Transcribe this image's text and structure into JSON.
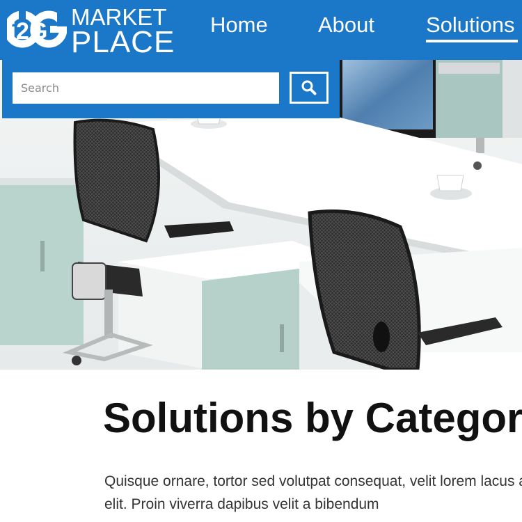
{
  "brand": {
    "logo_mark_text": "i2G",
    "logo_line1": "MARKET",
    "logo_line2": "PLACE",
    "primary_color": "#1b78c8"
  },
  "nav": {
    "items": [
      {
        "label": "Home",
        "active": false
      },
      {
        "label": "About",
        "active": false
      },
      {
        "label": "Solutions",
        "active": true
      }
    ]
  },
  "search": {
    "placeholder": "Search",
    "value": "",
    "button_icon": "search-icon"
  },
  "hero": {
    "image_subject": "office workstations with mesh chairs"
  },
  "main": {
    "title": "Solutions by Category",
    "paragraph": "Quisque ornare, tortor sed volutpat consequat, velit lorem lacus at, ultrices elit. Proin viverra dapibus velit a bibendum"
  }
}
